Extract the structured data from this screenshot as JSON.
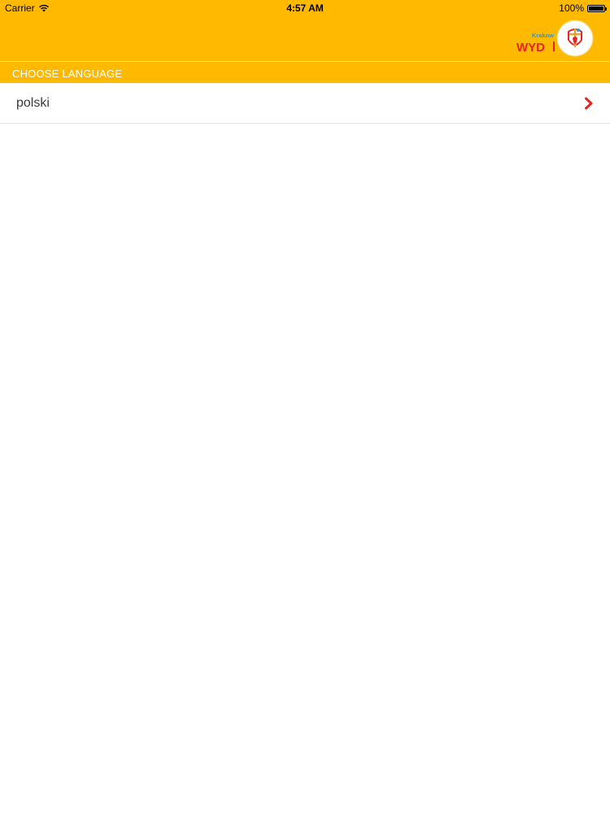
{
  "status_bar": {
    "carrier": "Carrier",
    "time": "4:57 AM",
    "battery_label": "100%",
    "battery_level": 1.0
  },
  "header": {
    "logo_text": "WYD",
    "logo_city": "Krakow",
    "colors": {
      "background": "#FFBA00",
      "logo_red": "#E52421",
      "logo_blue": "#2E9AD6"
    }
  },
  "section": {
    "title": "CHOOSE LANGUAGE"
  },
  "languages": [
    {
      "label": "polski"
    }
  ],
  "colors": {
    "accent": "#FFBA00",
    "chevron": "#E52421"
  }
}
